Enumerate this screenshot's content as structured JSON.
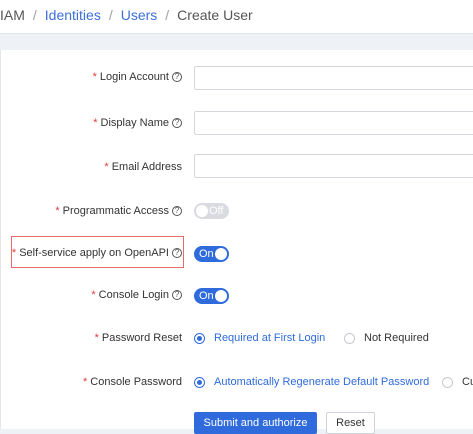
{
  "breadcrumb": {
    "items": [
      "IAM",
      "Identities",
      "Users",
      "Create User"
    ],
    "separator": "/"
  },
  "form": {
    "required_mark": "*",
    "help_glyph": "?",
    "login_account": {
      "label": "Login Account",
      "value": ""
    },
    "display_name": {
      "label": "Display Name",
      "value": ""
    },
    "email_address": {
      "label": "Email Address",
      "value": ""
    },
    "programmatic_access": {
      "label": "Programmatic Access",
      "state": "Off"
    },
    "self_service": {
      "label": "Self-service apply on OpenAPI",
      "state": "On"
    },
    "console_login": {
      "label": "Console Login",
      "state": "On"
    },
    "password_reset": {
      "label": "Password Reset",
      "options": [
        "Required at First Login",
        "Not Required"
      ],
      "selected": "Required at First Login"
    },
    "console_password": {
      "label": "Console Password",
      "options": [
        "Automatically Regenerate Default Password",
        "Cu"
      ],
      "selected": "Automatically Regenerate Default Password"
    }
  },
  "actions": {
    "submit_label": "Submit and authorize",
    "reset_label": "Reset"
  },
  "colors": {
    "accent": "#2f6bdc",
    "required": "#e4393c",
    "highlight_border": "#e56b6b"
  }
}
